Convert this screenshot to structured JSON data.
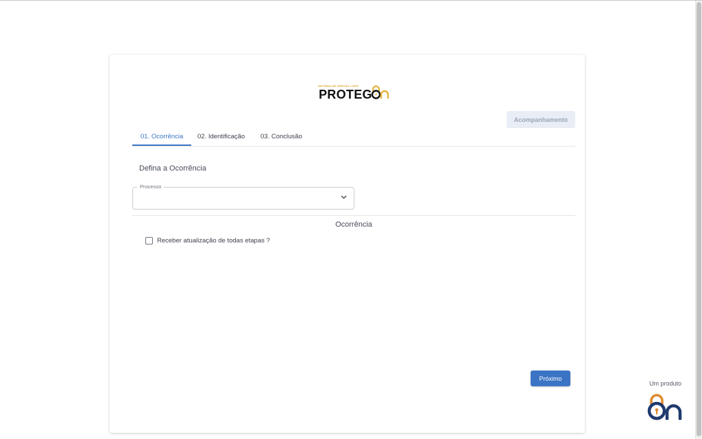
{
  "app": {
    "logo_tagline": "SISTEMA DE GESTÃO LGPD",
    "brand_name": "PROTEG",
    "brand_suffix": "On"
  },
  "header": {
    "tracking_button": "Acompanhamento"
  },
  "tabs": [
    {
      "label": "01. Ocorrência",
      "active": true
    },
    {
      "label": "02. Identificação",
      "active": false
    },
    {
      "label": "03. Conclusão",
      "active": false
    }
  ],
  "form": {
    "section_title": "Defina a Ocorrência",
    "process_field": {
      "label": "Processo",
      "value": "",
      "icon": "chevron-down-icon"
    },
    "subsection_title": "Ocorrência",
    "updates_checkbox": {
      "label": "Receber atualização de todas etapas ?",
      "checked": false
    },
    "next_button": "Próximo"
  },
  "footer": {
    "caption": "Um produto",
    "logo": "on-lock-icon"
  },
  "colors": {
    "accent": "#3b74c5",
    "brand_gold": "#e8b23a",
    "brand_orange": "#e0892b",
    "brand_navy": "#1f3a6e"
  }
}
